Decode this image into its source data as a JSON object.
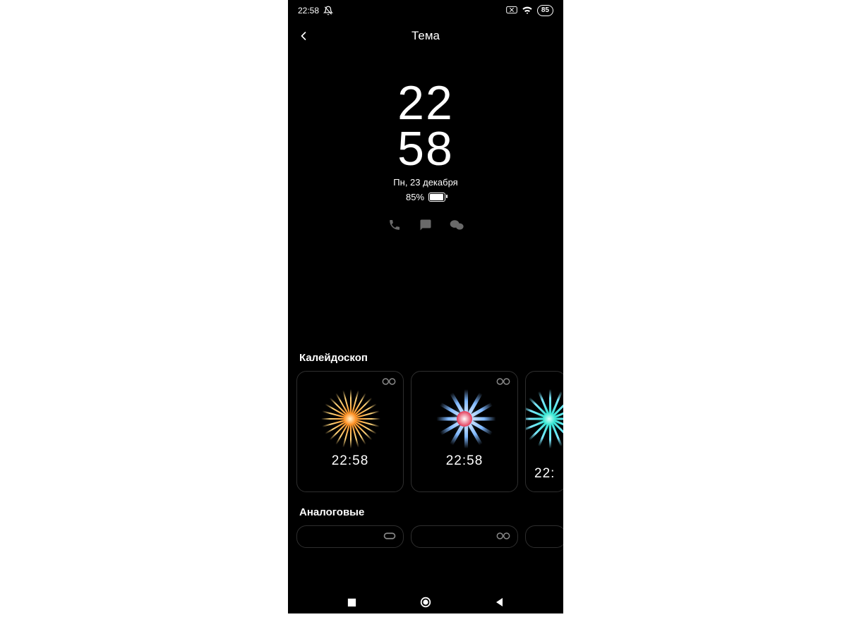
{
  "statusbar": {
    "time": "22:58",
    "battery_label": "85"
  },
  "header": {
    "title": "Тема"
  },
  "preview": {
    "hour": "22",
    "minute": "58",
    "date": "Пн, 23 декабря",
    "battery_text": "85%"
  },
  "sections": [
    {
      "title": "Калейдоскоп",
      "cards": [
        {
          "time": "22:58",
          "variant": "orange"
        },
        {
          "time": "22:58",
          "variant": "blue"
        },
        {
          "time": "22:",
          "variant": "teal",
          "partial": true
        }
      ]
    },
    {
      "title": "Аналоговые",
      "cards": [
        {
          "toggle": "single"
        },
        {
          "toggle": "loop"
        },
        {
          "toggle": "none",
          "partial": true
        }
      ]
    }
  ]
}
